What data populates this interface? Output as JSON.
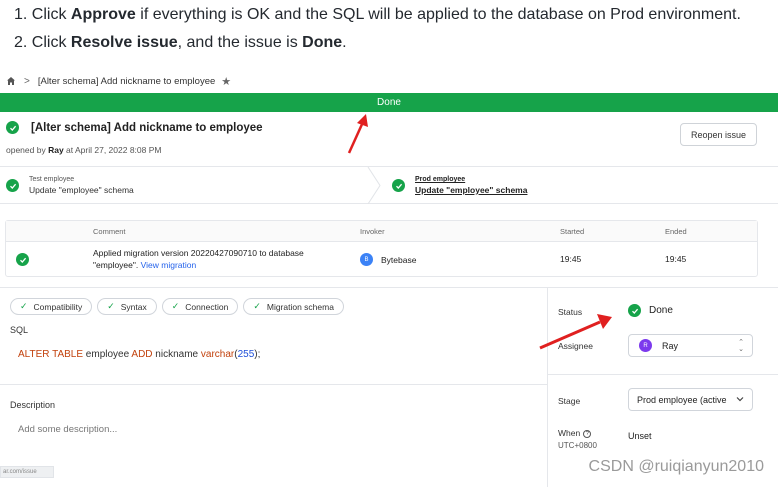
{
  "instructions": {
    "line1_pre": "1. Click ",
    "line1_bold": "Approve",
    "line1_post": " if everything is OK and the SQL will be applied to the database on Prod environment.",
    "line2_pre": "2. Click ",
    "line2_bold": "Resolve issue",
    "line2_mid": ", and the issue is ",
    "line2_bold2": "Done",
    "line2_post": "."
  },
  "breadcrumb": {
    "home_icon": "home-icon",
    "separator": ">",
    "title": "[Alter schema] Add nickname to employee",
    "star_icon": "star-icon"
  },
  "banner": {
    "text": "Done",
    "color": "#16a34a"
  },
  "issue": {
    "title": "[Alter schema] Add nickname to employee",
    "meta_pre": "opened by ",
    "author": "Ray",
    "meta_post": " at April 27, 2022 8:08 PM",
    "reopen_label": "Reopen issue"
  },
  "pipeline": {
    "stages": [
      {
        "name": "Test employee",
        "desc": "Update \"employee\" schema"
      },
      {
        "name": "Prod employee",
        "desc": "Update \"employee\" schema"
      }
    ]
  },
  "task_table": {
    "headers": [
      "Comment",
      "Invoker",
      "Started",
      "Ended"
    ],
    "row": {
      "comment_line1": "Applied migration version 20220427090710 to database",
      "comment_line2": "\"employee\".",
      "link": "View migration",
      "invoker_initial": "B",
      "invoker": "Bytebase",
      "started": "19:45",
      "ended": "19:45"
    }
  },
  "checks": [
    "Compatibility",
    "Syntax",
    "Connection",
    "Migration schema"
  ],
  "sql": {
    "label": "SQL",
    "kw1": "ALTER TABLE",
    "t1": " employee ",
    "kw2": "ADD",
    "t2": " nickname ",
    "kw3": "varchar",
    "t3": "(",
    "num": "255",
    "t4": ");"
  },
  "description": {
    "label": "Description",
    "placeholder": "Add some description..."
  },
  "corner_tab": "ar.com/issue",
  "sidebar": {
    "status_label": "Status",
    "status_value": "Done",
    "assignee_label": "Assignee",
    "assignee_initial": "R",
    "assignee": "Ray",
    "stage_label": "Stage",
    "stage_value": "Prod employee (active",
    "when_label": "When",
    "tz": "UTC+0800",
    "when_value": "Unset"
  },
  "watermark": "CSDN @ruiqianyun2010",
  "colors": {
    "success": "#16a34a",
    "link": "#2563eb",
    "keyword": "#c2410c",
    "annotation_arrow": "#e02020"
  }
}
